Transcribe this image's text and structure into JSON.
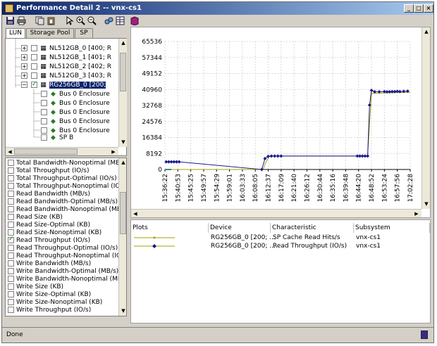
{
  "window": {
    "title": "Performance Detail 2 -- vnx-cs1",
    "minimize_label": "_",
    "maximize_label": "□",
    "close_label": "×"
  },
  "tabs": [
    {
      "label": "LUN",
      "active": true
    },
    {
      "label": "Storage Pool",
      "active": false
    },
    {
      "label": "SP",
      "active": false
    }
  ],
  "tree": [
    {
      "label": "NL512GB_0 [400; R",
      "icon": "disk-icon",
      "checked": false,
      "expander": "+"
    },
    {
      "label": "NL512GB_1 [401; R",
      "icon": "disk-icon",
      "checked": false,
      "expander": "+"
    },
    {
      "label": "NL512GB_2 [402; R",
      "icon": "disk-icon",
      "checked": false,
      "expander": "+"
    },
    {
      "label": "NL512GB_3 [403; R",
      "icon": "disk-icon",
      "checked": false,
      "expander": "+"
    },
    {
      "label": "RG256GB_0 [200; ",
      "icon": "disk-icon",
      "checked": true,
      "expander": "−",
      "selected": true
    },
    {
      "label": "Bus 0 Enclosure",
      "icon": "drive-icon",
      "checked": false
    },
    {
      "label": "Bus 0 Enclosure",
      "icon": "drive-icon",
      "checked": false
    },
    {
      "label": "Bus 0 Enclosure",
      "icon": "drive-icon",
      "checked": false
    },
    {
      "label": "Bus 0 Enclosure",
      "icon": "drive-icon",
      "checked": false
    },
    {
      "label": "Bus 0 Enclosure",
      "icon": "drive-icon",
      "checked": false
    },
    {
      "label": "SP B",
      "icon": "sp-icon",
      "checked": false
    }
  ],
  "metrics": [
    {
      "label": "Total Bandwidth-Nonoptimal (MB/",
      "checked": false
    },
    {
      "label": "Total Throughput (IO/s)",
      "checked": false
    },
    {
      "label": "Total Throughput-Optimal (IO/s)",
      "checked": false
    },
    {
      "label": "Total Throughput-Nonoptimal (IO/",
      "checked": false
    },
    {
      "label": "Read Bandwidth (MB/s)",
      "checked": false
    },
    {
      "label": "Read Bandwidth-Optimal (MB/s)",
      "checked": false
    },
    {
      "label": "Read Bandwidth-Nonoptimal (MB/",
      "checked": false
    },
    {
      "label": "Read Size (KB)",
      "checked": false
    },
    {
      "label": "Read Size-Optimal (KB)",
      "checked": false
    },
    {
      "label": "Read Size-Nonoptimal (KB)",
      "checked": false
    },
    {
      "label": "Read Throughput (IO/s)",
      "checked": true
    },
    {
      "label": "Read Throughput-Optimal (IO/s)",
      "checked": false
    },
    {
      "label": "Read Throughput-Nonoptimal (IO",
      "checked": false
    },
    {
      "label": "Write Bandwidth (MB/s)",
      "checked": false
    },
    {
      "label": "Write Bandwidth-Optimal (MB/s)",
      "checked": false
    },
    {
      "label": "Write Bandwidth-Nonoptimal (MB/",
      "checked": false
    },
    {
      "label": "Write Size (KB)",
      "checked": false
    },
    {
      "label": "Write Size-Optimal (KB)",
      "checked": false
    },
    {
      "label": "Write Size-Nonoptimal (KB)",
      "checked": false
    },
    {
      "label": "Write Throughput (IO/s)",
      "checked": false
    }
  ],
  "chart_data": {
    "type": "line",
    "ylim": [
      0,
      65536
    ],
    "y_ticks": [
      "0",
      "8192",
      "16384",
      "24576",
      "32768",
      "40960",
      "49152",
      "57344",
      "65536"
    ],
    "y_tick_values": [
      0,
      8192,
      16384,
      24576,
      32768,
      40960,
      49152,
      57344,
      65536
    ],
    "x_ticks": [
      "15:36:22",
      "15:40:53",
      "15:45:25",
      "15:49:57",
      "15:54:29",
      "15:59:01",
      "16:03:33",
      "16:08:05",
      "16:12:37",
      "16:17:09",
      "16:21:40",
      "16:26:12",
      "16:30:44",
      "16:35:16",
      "16:39:48",
      "16:44:20",
      "16:48:52",
      "16:53:24",
      "16:57:56",
      "17:02:28"
    ],
    "grid": true,
    "series": [
      {
        "color": "#a0a000",
        "x": [
          0,
          0.5,
          7.6,
          7.8,
          8.1,
          13.8,
          15.7,
          16.0,
          19.0
        ],
        "y": [
          0,
          0,
          0,
          3500,
          6900,
          6900,
          6900,
          39000,
          39500
        ]
      },
      {
        "color": "#1a1a8c",
        "x": [
          0.1,
          0.3,
          0.5,
          0.7,
          0.9,
          1.1,
          7.5,
          7.75,
          8.0,
          8.25,
          8.5,
          8.75,
          9.0,
          14.9,
          15.1,
          15.3,
          15.5,
          15.7,
          15.85,
          16.0,
          16.25,
          16.6,
          17.0,
          17.2,
          17.4,
          17.6,
          17.8,
          18.0,
          18.2,
          18.5,
          18.8
        ],
        "y": [
          3900,
          3900,
          3900,
          3900,
          3900,
          3900,
          0,
          5600,
          6700,
          6900,
          6900,
          6900,
          6900,
          6900,
          6900,
          6900,
          6900,
          6900,
          33000,
          40500,
          39800,
          39800,
          39900,
          39800,
          39800,
          39900,
          39900,
          40000,
          39900,
          40000,
          40100
        ]
      }
    ]
  },
  "table": {
    "headers": [
      "Plots",
      "Device",
      "Characteristic",
      "Subsystem"
    ],
    "rows": [
      {
        "plot_color": "#a0a000",
        "device": "RG256GB_0 [200; ...",
        "characteristic": "SP Cache Read Hits/s",
        "subsystem": "vnx-cs1"
      },
      {
        "plot_color": "#1a1a8c",
        "device": "RG256GB_0 [200; ...",
        "characteristic": "Read Throughput (IO/s)",
        "subsystem": "vnx-cs1"
      }
    ]
  },
  "status": {
    "text": "Done"
  }
}
